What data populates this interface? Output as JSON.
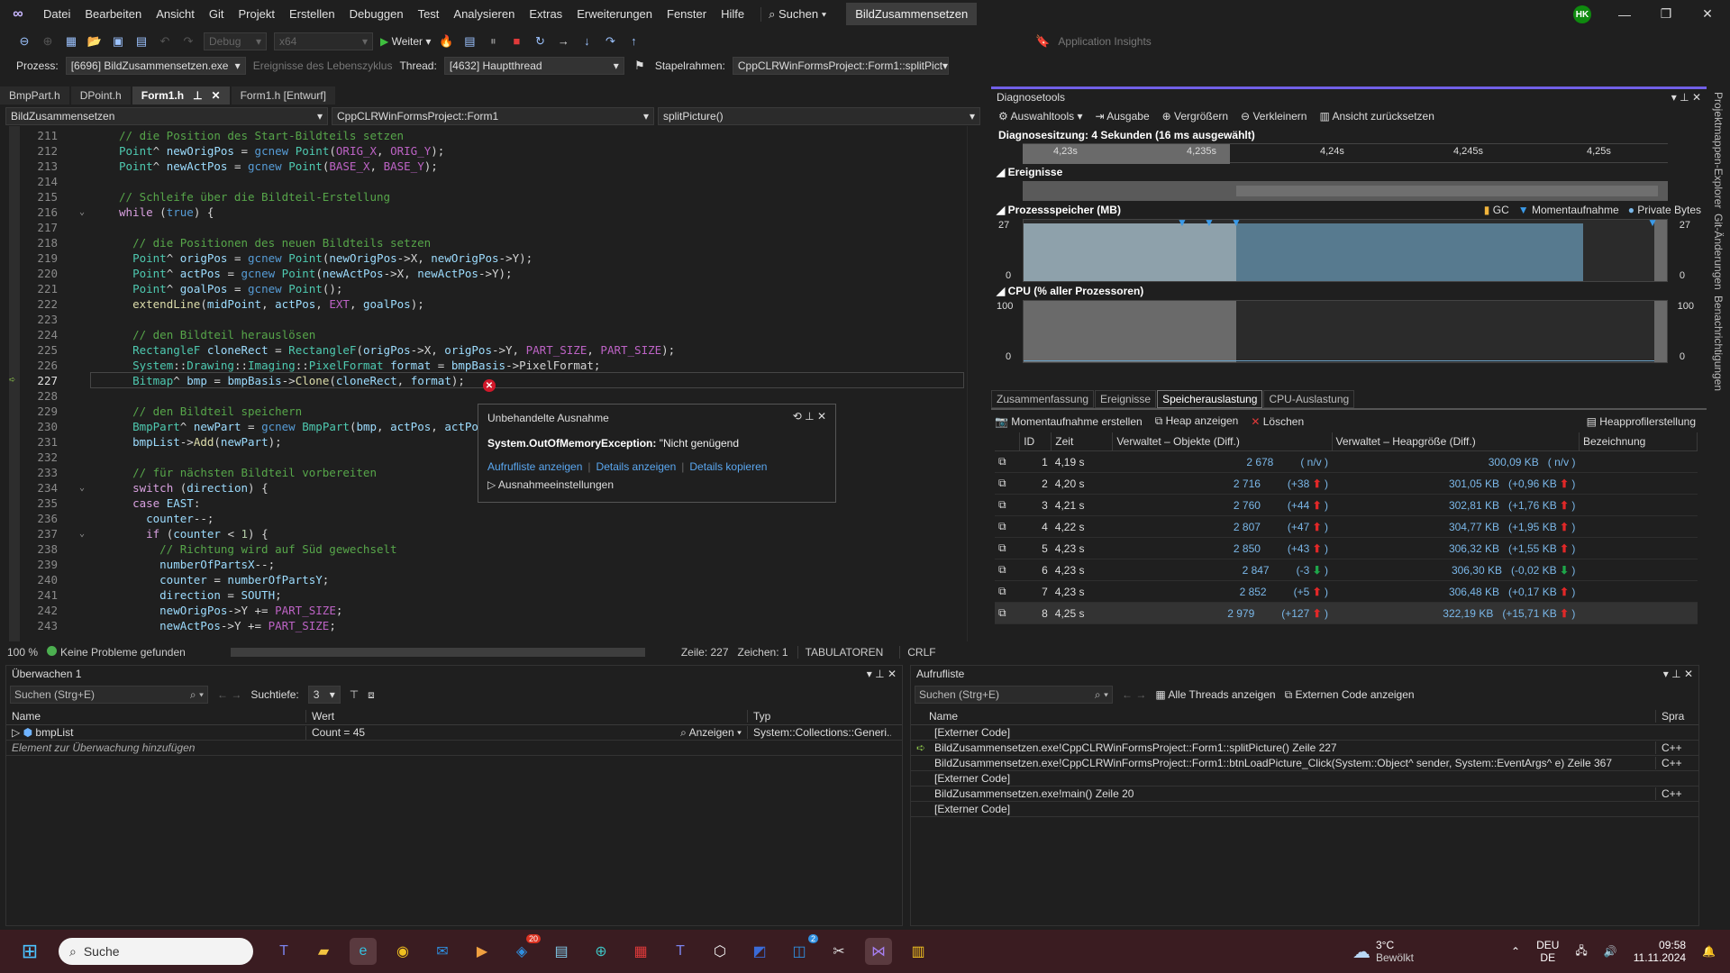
{
  "titlebar": {
    "menu": [
      "Datei",
      "Bearbeiten",
      "Ansicht",
      "Git",
      "Projekt",
      "Erstellen",
      "Debuggen",
      "Test",
      "Analysieren",
      "Extras",
      "Erweiterungen",
      "Fenster",
      "Hilfe"
    ],
    "search_label": "Suchen",
    "solution_title": "BildZusammensetzen",
    "avatar_initials": "HK"
  },
  "toolbar": {
    "config": "Debug",
    "platform": "x64",
    "continue_label": "Weiter",
    "app_insights": "Application Insights",
    "process_label": "Prozess:",
    "process_value": "[6696] BildZusammensetzen.exe",
    "lifecycle_label": "Ereignisse des Lebenszyklus",
    "thread_label": "Thread:",
    "thread_value": "[4632] Hauptthread",
    "stackframe_label": "Stapelrahmen:",
    "stackframe_value": "CppCLRWinFormsProject::Form1::splitPict"
  },
  "doc_tabs": [
    {
      "label": "BmpPart.h"
    },
    {
      "label": "DPoint.h"
    },
    {
      "label": "Form1.h",
      "active": true
    },
    {
      "label": "Form1.h [Entwurf]"
    }
  ],
  "navbar": {
    "project": "BildZusammensetzen",
    "scope": "CppCLRWinFormsProject::Form1",
    "member": "splitPicture()"
  },
  "editor": {
    "current_line": 227,
    "lines": [
      {
        "n": 211,
        "html": "<span class='c-com'>// die Position des Start-Bildteils setzen</span>"
      },
      {
        "n": 212,
        "html": "<span class='c-ty'>Point</span>^ <span class='c-var'>newOrigPos</span> = <span class='c-kw2'>gcnew</span> <span class='c-ty'>Point</span>(<span class='c-mac'>ORIG_X</span>, <span class='c-mac'>ORIG_Y</span>);"
      },
      {
        "n": 213,
        "html": "<span class='c-ty'>Point</span>^ <span class='c-var'>newActPos</span> = <span class='c-kw2'>gcnew</span> <span class='c-ty'>Point</span>(<span class='c-mac'>BASE_X</span>, <span class='c-mac'>BASE_Y</span>);"
      },
      {
        "n": 214,
        "html": ""
      },
      {
        "n": 215,
        "html": "<span class='c-com'>// Schleife über die Bildteil-Erstellung</span>"
      },
      {
        "n": 216,
        "html": "<span class='c-kw'>while</span> (<span class='c-kw2'>true</span>) {",
        "fold": true
      },
      {
        "n": 217,
        "html": ""
      },
      {
        "n": 218,
        "html": "  <span class='c-com'>// die Positionen des neuen Bildteils setzen</span>"
      },
      {
        "n": 219,
        "html": "  <span class='c-ty'>Point</span>^ <span class='c-var'>origPos</span> = <span class='c-kw2'>gcnew</span> <span class='c-ty'>Point</span>(<span class='c-var'>newOrigPos</span>-&gt;X, <span class='c-var'>newOrigPos</span>-&gt;Y);"
      },
      {
        "n": 220,
        "html": "  <span class='c-ty'>Point</span>^ <span class='c-var'>actPos</span> = <span class='c-kw2'>gcnew</span> <span class='c-ty'>Point</span>(<span class='c-var'>newActPos</span>-&gt;X, <span class='c-var'>newActPos</span>-&gt;Y);"
      },
      {
        "n": 221,
        "html": "  <span class='c-ty'>Point</span>^ <span class='c-var'>goalPos</span> = <span class='c-kw2'>gcnew</span> <span class='c-ty'>Point</span>();"
      },
      {
        "n": 222,
        "html": "  <span class='c-fn'>extendLine</span>(<span class='c-var'>midPoint</span>, <span class='c-var'>actPos</span>, <span class='c-mac'>EXT</span>, <span class='c-var'>goalPos</span>);"
      },
      {
        "n": 223,
        "html": ""
      },
      {
        "n": 224,
        "html": "  <span class='c-com'>// den Bildteil herauslösen</span>"
      },
      {
        "n": 225,
        "html": "  <span class='c-ty'>RectangleF</span> <span class='c-var'>cloneRect</span> = <span class='c-ty'>RectangleF</span>(<span class='c-var'>origPos</span>-&gt;X, <span class='c-var'>origPos</span>-&gt;Y, <span class='c-mac'>PART_SIZE</span>, <span class='c-mac'>PART_SIZE</span>);"
      },
      {
        "n": 226,
        "html": "  <span class='c-ty'>System</span>::<span class='c-ty'>Drawing</span>::<span class='c-ty'>Imaging</span>::<span class='c-ty'>PixelFormat</span> <span class='c-var'>format</span> = <span class='c-var'>bmpBasis</span>-&gt;PixelFormat;"
      },
      {
        "n": 227,
        "html": "  <span class='c-ty'>Bitmap</span>^ <span class='c-var'>bmp</span> = <span class='c-var'>bmpBasis</span>-&gt;<span class='c-fn'>Clone</span>(<span class='c-var'>cloneRect</span>, <span class='c-var'>format</span>);"
      },
      {
        "n": 228,
        "html": ""
      },
      {
        "n": 229,
        "html": "  <span class='c-com'>// den Bildteil speichern</span>"
      },
      {
        "n": 230,
        "html": "  <span class='c-ty'>BmpPart</span>^ <span class='c-var'>newPart</span> = <span class='c-kw2'>gcnew</span> <span class='c-ty'>BmpPart</span>(<span class='c-var'>bmp</span>, <span class='c-var'>actPos</span>, <span class='c-var'>actPos</span>);"
      },
      {
        "n": 231,
        "html": "  <span class='c-var'>bmpList</span>-&gt;<span class='c-fn'>Add</span>(<span class='c-var'>newPart</span>);"
      },
      {
        "n": 232,
        "html": ""
      },
      {
        "n": 233,
        "html": "  <span class='c-com'>// für nächsten Bildteil vorbereiten</span>"
      },
      {
        "n": 234,
        "html": "  <span class='c-kw'>switch</span> (<span class='c-var'>direction</span>) {",
        "fold": true
      },
      {
        "n": 235,
        "html": "  <span class='c-kw'>case</span> <span class='c-var'>EAST</span>:"
      },
      {
        "n": 236,
        "html": "    <span class='c-var'>counter</span>--;"
      },
      {
        "n": 237,
        "html": "    <span class='c-kw'>if</span> (<span class='c-var'>counter</span> &lt; <span class='c-num'>1</span>) {",
        "fold": true
      },
      {
        "n": 238,
        "html": "      <span class='c-com'>// Richtung wird auf Süd gewechselt</span>"
      },
      {
        "n": 239,
        "html": "      <span class='c-var'>numberOfPartsX</span>--;"
      },
      {
        "n": 240,
        "html": "      <span class='c-var'>counter</span> = <span class='c-var'>numberOfPartsY</span>;"
      },
      {
        "n": 241,
        "html": "      <span class='c-var'>direction</span> = <span class='c-var'>SOUTH</span>;"
      },
      {
        "n": 242,
        "html": "      <span class='c-var'>newOrigPos</span>-&gt;Y += <span class='c-mac'>PART_SIZE</span>;"
      },
      {
        "n": 243,
        "html": "      <span class='c-var'>newActPos</span>-&gt;Y += <span class='c-mac'>PART_SIZE</span>;"
      }
    ]
  },
  "exception": {
    "title": "Unbehandelte Ausnahme",
    "type": "System.OutOfMemoryException:",
    "message": " \"Nicht genügend",
    "links": [
      "Aufrufliste anzeigen",
      "Details anzeigen",
      "Details kopieren"
    ],
    "settings": "Ausnahmeeinstellungen"
  },
  "editor_status": {
    "zoom": "100 %",
    "problems": "Keine Probleme gefunden",
    "line": "Zeile: 227",
    "char": "Zeichen: 1",
    "indent": "TABULATOREN",
    "eol": "CRLF"
  },
  "diag": {
    "title": "Diagnosetools",
    "tools": [
      "Auswahltools",
      "Ausgabe",
      "Vergrößern",
      "Verkleinern",
      "Ansicht zurücksetzen"
    ],
    "session": "Diagnosesitzung: 4 Sekunden (16 ms ausgewählt)",
    "ruler_ticks": [
      "4,23s",
      "4,235s",
      "4,24s",
      "4,245s",
      "4,25s"
    ],
    "events_label": "Ereignisse",
    "memory_label": "Prozessspeicher (MB)",
    "legend": [
      "GC",
      "Momentaufnahme",
      "Private Bytes"
    ],
    "mem_max": "27",
    "mem_min": "0",
    "cpu_label": "CPU (% aller Prozessoren)",
    "cpu_max": "100",
    "cpu_min": "0",
    "tabs": [
      "Zusammenfassung",
      "Ereignisse",
      "Speicherauslastung",
      "CPU-Auslastung"
    ],
    "active_tab": 2,
    "snap_actions": [
      "Momentaufnahme erstellen",
      "Heap anzeigen",
      "Löschen"
    ],
    "heap_profiling": "Heapprofilerstellung",
    "columns": [
      "ID",
      "Zeit",
      "Verwaltet – Objekte (Diff.)",
      "Verwaltet – Heapgröße (Diff.)",
      "Bezeichnung"
    ],
    "snapshots": [
      {
        "id": "1",
        "time": "4,19 s",
        "objects": "2 678",
        "obj_diff": "( n/v )",
        "obj_dir": "",
        "heap": "300,09 KB",
        "heap_diff": "( n/v )",
        "heap_dir": ""
      },
      {
        "id": "2",
        "time": "4,20 s",
        "objects": "2 716",
        "obj_diff": "(+38",
        "obj_dir": "up",
        "heap": "301,05 KB",
        "heap_diff": "(+0,96 KB",
        "heap_dir": "up"
      },
      {
        "id": "3",
        "time": "4,21 s",
        "objects": "2 760",
        "obj_diff": "(+44",
        "obj_dir": "up",
        "heap": "302,81 KB",
        "heap_diff": "(+1,76 KB",
        "heap_dir": "up"
      },
      {
        "id": "4",
        "time": "4,22 s",
        "objects": "2 807",
        "obj_diff": "(+47",
        "obj_dir": "up",
        "heap": "304,77 KB",
        "heap_diff": "(+1,95 KB",
        "heap_dir": "up"
      },
      {
        "id": "5",
        "time": "4,23 s",
        "objects": "2 850",
        "obj_diff": "(+43",
        "obj_dir": "up",
        "heap": "306,32 KB",
        "heap_diff": "(+1,55 KB",
        "heap_dir": "up"
      },
      {
        "id": "6",
        "time": "4,23 s",
        "objects": "2 847",
        "obj_diff": "(-3",
        "obj_dir": "down",
        "heap": "306,30 KB",
        "heap_diff": "(-0,02 KB",
        "heap_dir": "down"
      },
      {
        "id": "7",
        "time": "4,23 s",
        "objects": "2 852",
        "obj_diff": "(+5",
        "obj_dir": "up",
        "heap": "306,48 KB",
        "heap_diff": "(+0,17 KB",
        "heap_dir": "up"
      },
      {
        "id": "8",
        "time": "4,25 s",
        "objects": "2 979",
        "obj_diff": "(+127",
        "obj_dir": "up",
        "heap": "322,19 KB",
        "heap_diff": "(+15,71 KB",
        "heap_dir": "up"
      }
    ]
  },
  "side_rail": [
    "Projektmappen-Explorer",
    "Git-Änderungen",
    "Benachrichtigungen"
  ],
  "watch": {
    "title": "Überwachen 1",
    "search_placeholder": "Suchen (Strg+E)",
    "depth_label": "Suchtiefe:",
    "depth_value": "3",
    "columns": [
      "Name",
      "Wert",
      "Typ"
    ],
    "rows": [
      {
        "name": "bmpList",
        "value": "Count = 45",
        "view": "Anzeigen",
        "type": "System::Collections::Generi..."
      }
    ],
    "add_hint": "Element zur Überwachung hinzufügen"
  },
  "callstack": {
    "title": "Aufrufliste",
    "search_placeholder": "Suchen (Strg+E)",
    "all_threads": "Alle Threads anzeigen",
    "external_code": "Externen Code anzeigen",
    "columns": [
      "Name",
      "Spra"
    ],
    "rows": [
      {
        "name": "[Externer Code]",
        "lang": ""
      },
      {
        "name": "BildZusammensetzen.exe!CppCLRWinFormsProject::Form1::splitPicture() Zeile 227",
        "lang": "C++",
        "current": true
      },
      {
        "name": "BildZusammensetzen.exe!CppCLRWinFormsProject::Form1::btnLoadPicture_Click(System::Object^ sender, System::EventArgs^ e) Zeile 367",
        "lang": "C++"
      },
      {
        "name": "[Externer Code]",
        "lang": ""
      },
      {
        "name": "BildZusammensetzen.exe!main() Zeile 20",
        "lang": "C++"
      },
      {
        "name": "[Externer Code]",
        "lang": ""
      }
    ]
  },
  "taskbar": {
    "search": "Suche",
    "badges": {
      "mail": "20",
      "store": "2"
    },
    "weather_temp": "3°C",
    "weather_desc": "Bewölkt",
    "lang1": "DEU",
    "lang2": "DE",
    "time": "09:58",
    "date": "11.11.2024"
  }
}
